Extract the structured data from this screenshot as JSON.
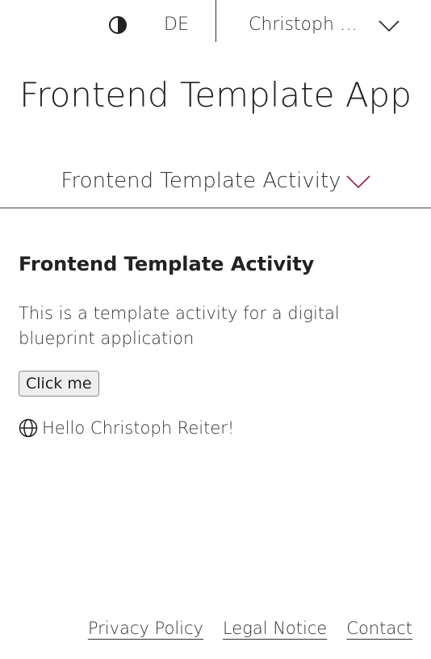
{
  "header": {
    "theme_toggle_icon": "contrast-icon",
    "language": "DE",
    "user_name": "Christoph Reiter",
    "user_menu_icon": "chevron-down-icon"
  },
  "app": {
    "title": "Frontend Template App"
  },
  "activity_nav": {
    "label": "Frontend Template Activity",
    "chevron_icon": "chevron-down-icon",
    "accent_color": "#9e1e4c"
  },
  "main": {
    "heading": "Frontend Template Activity",
    "description": "This is a template activity for a digital blueprint application",
    "button_label": "Click me",
    "greeting_icon": "globe-icon",
    "greeting": "Hello Christoph Reiter!"
  },
  "footer": {
    "links": [
      {
        "label": "Privacy Policy"
      },
      {
        "label": "Legal Notice"
      },
      {
        "label": "Contact"
      }
    ]
  }
}
